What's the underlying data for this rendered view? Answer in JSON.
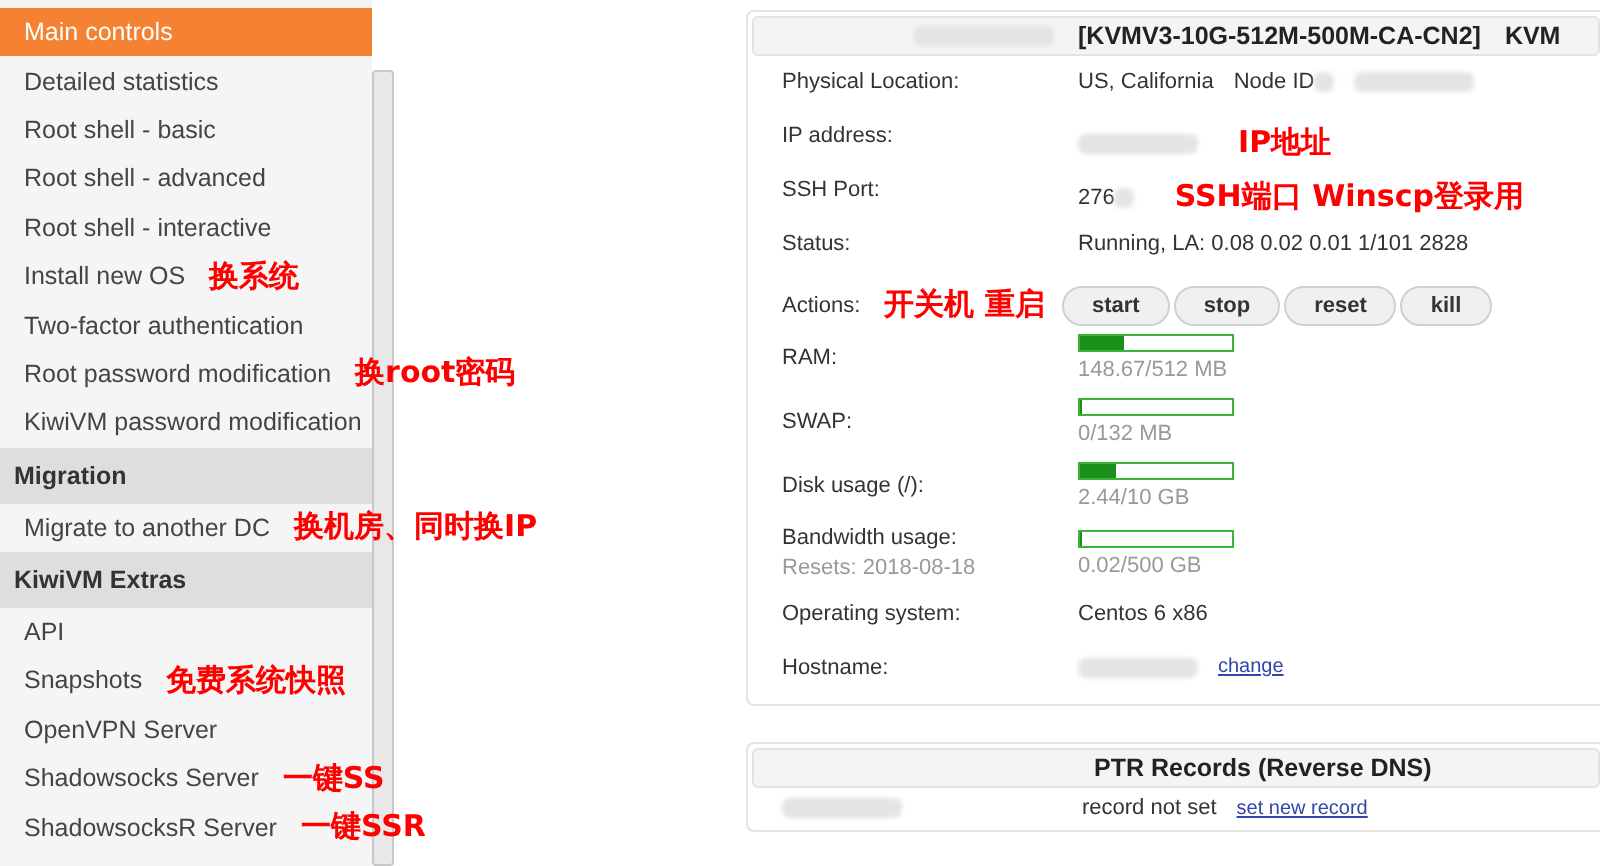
{
  "sidebar": {
    "sections": [
      {
        "items": [
          {
            "label": "Main controls",
            "selected": true
          },
          {
            "label": "Detailed statistics",
            "selected": false
          },
          {
            "label": "Root shell - basic",
            "selected": false
          },
          {
            "label": "Root shell - advanced",
            "selected": false
          },
          {
            "label": "Root shell - interactive",
            "selected": false
          },
          {
            "label": "Install new OS",
            "selected": false,
            "note": "换系统"
          },
          {
            "label": "Two-factor authentication",
            "selected": false
          },
          {
            "label": "Root password modification",
            "selected": false,
            "note": "换root密码"
          },
          {
            "label": "KiwiVM password modification",
            "selected": false
          }
        ]
      },
      {
        "heading": "Migration",
        "items": [
          {
            "label": "Migrate to another DC",
            "selected": false,
            "note": "换机房、同时换IP"
          }
        ]
      },
      {
        "heading": "KiwiVM Extras",
        "items": [
          {
            "label": "API",
            "selected": false
          },
          {
            "label": "Snapshots",
            "selected": false,
            "note": "免费系统快照"
          },
          {
            "label": "OpenVPN Server",
            "selected": false
          },
          {
            "label": "Shadowsocks Server",
            "selected": false,
            "note": "一键SS"
          },
          {
            "label": "ShadowsocksR Server",
            "selected": false,
            "note": "一键SSR"
          }
        ]
      }
    ]
  },
  "server_panel": {
    "title": "[KVMV3-10G-512M-500M-CA-CN2]",
    "type": "KVM",
    "rows": [
      {
        "label": "Physical Location:",
        "parts": [
          {
            "kind": "text",
            "text": "US, California"
          },
          {
            "kind": "text",
            "text": "Node ID"
          },
          {
            "kind": "redacted"
          },
          {
            "kind": "redacted"
          }
        ]
      },
      {
        "label": "IP address:",
        "parts": [
          {
            "kind": "redacted"
          },
          {
            "kind": "note",
            "text": "IP地址"
          }
        ]
      },
      {
        "label": "SSH Port:",
        "parts": [
          {
            "kind": "text",
            "text": "276"
          },
          {
            "kind": "redacted"
          },
          {
            "kind": "note",
            "text": "SSH端口 Winscp登录用"
          }
        ]
      },
      {
        "label": "Status:",
        "parts": [
          {
            "kind": "text",
            "text": "Running, LA: 0.08 0.02 0.01 1/101 2828"
          }
        ]
      },
      {
        "label": "Actions:",
        "label_note": "开关机 重启",
        "parts": [
          {
            "kind": "button",
            "text": "start"
          },
          {
            "kind": "button",
            "text": "stop"
          },
          {
            "kind": "button",
            "text": "reset"
          },
          {
            "kind": "button",
            "text": "kill"
          }
        ]
      },
      {
        "label": "RAM:",
        "parts": [
          {
            "kind": "meter",
            "level": 0.29,
            "reading": "148.67/512 MB"
          }
        ]
      },
      {
        "label": "SWAP:",
        "parts": [
          {
            "kind": "meter",
            "level": 0,
            "reading": "0/132 MB"
          }
        ]
      },
      {
        "label": "Disk usage (/):",
        "parts": [
          {
            "kind": "meter",
            "level": 0.24,
            "reading": "2.44/10 GB"
          }
        ]
      },
      {
        "label": "Bandwidth usage:",
        "sublabel": "Resets: 2018-08-18",
        "parts": [
          {
            "kind": "meter",
            "level": 0,
            "reading": "0.02/500 GB"
          }
        ]
      },
      {
        "label": "Operating system:",
        "parts": [
          {
            "kind": "text",
            "text": "Centos 6 x86"
          }
        ]
      },
      {
        "label": "Hostname:",
        "parts": [
          {
            "kind": "redacted"
          },
          {
            "kind": "link",
            "text": "change"
          }
        ]
      }
    ]
  },
  "ptr_panel": {
    "title": "PTR Records (Reverse DNS)",
    "status": "record not set",
    "link": "set new record"
  }
}
